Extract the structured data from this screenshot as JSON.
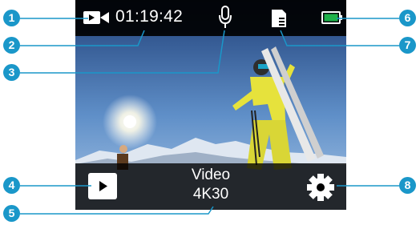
{
  "status_bar": {
    "mode_icon": "video-camera-icon",
    "recording_time": "01:19:42",
    "mic_icon": "microphone-icon",
    "sd_icon": "sd-card-icon",
    "battery_icon": "battery-icon",
    "battery_color": "#1fb24a"
  },
  "bottom_bar": {
    "mode_label": "Video",
    "resolution_label": "4K30",
    "playback_icon": "play-icon",
    "settings_icon": "gear-icon"
  },
  "callouts": [
    "1",
    "2",
    "3",
    "4",
    "5",
    "6",
    "7",
    "8"
  ],
  "colors": {
    "callout": "#1a97c9",
    "bar": "#000000"
  }
}
